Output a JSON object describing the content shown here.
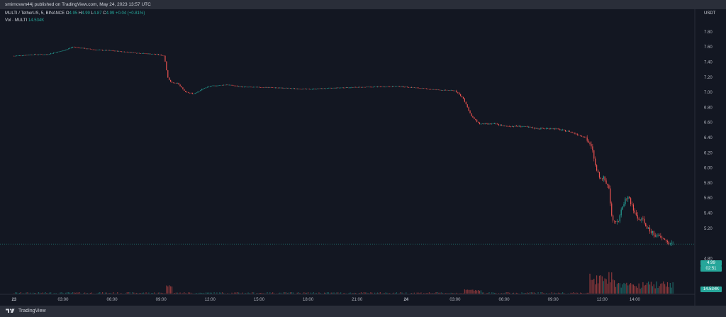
{
  "publisher": {
    "text": "smirnovwn44j published on TradingView.com, May 24, 2023 13:57 UTC"
  },
  "legend": {
    "symbol": "MULTI / TetherUS, 5, BINANCE",
    "o_label": "O",
    "o_value": "4.95",
    "h_label": "H",
    "h_value": "4.99",
    "l_label": "L",
    "l_value": "4.87",
    "c_label": "C",
    "c_value": "4.99",
    "change": "+0.04 (+0.81%)",
    "vol_label": "Vol · MULTI",
    "vol_value": "14.534K"
  },
  "currency": "USDT",
  "price_badge": {
    "price": "4.99",
    "countdown": "02:51"
  },
  "volume_badge": "14.534K",
  "brand": "TradingView",
  "colors": {
    "up": "#26a69a",
    "down": "#ef5350",
    "background": "#131722",
    "text": "#d1d4dc"
  },
  "chart_data": {
    "type": "candlestick",
    "yaxis_labels": [
      "7.80",
      "7.60",
      "7.40",
      "7.20",
      "7.00",
      "6.80",
      "6.60",
      "6.40",
      "6.20",
      "6.00",
      "5.80",
      "5.60",
      "5.40",
      "5.20",
      "4.80"
    ],
    "ylim": [
      4.55,
      7.93
    ],
    "last_price": 4.99,
    "xaxis_labels": [
      "23",
      "03:00",
      "06:00",
      "09:00",
      "12:00",
      "15:00",
      "18:00",
      "21:00",
      "24",
      "03:00",
      "06:00",
      "09:00",
      "12:00",
      "14:00"
    ],
    "xaxis_hours": [
      0,
      3,
      6,
      9,
      12,
      15,
      18,
      21,
      24,
      27,
      30,
      33,
      36,
      38
    ],
    "x_range_hours": [
      -0.6,
      38.0
    ],
    "interval_minutes": 5,
    "price_path": [
      [
        0,
        7.48
      ],
      [
        1.2,
        7.5
      ],
      [
        2,
        7.5
      ],
      [
        3,
        7.55
      ],
      [
        3.6,
        7.6
      ],
      [
        5,
        7.56
      ],
      [
        6,
        7.55
      ],
      [
        7.5,
        7.52
      ],
      [
        8.8,
        7.5
      ],
      [
        9.2,
        7.48
      ],
      [
        9.4,
        7.2
      ],
      [
        9.6,
        7.13
      ],
      [
        10,
        7.12
      ],
      [
        10.5,
        7.0
      ],
      [
        11,
        6.98
      ],
      [
        11.6,
        7.05
      ],
      [
        12,
        7.08
      ],
      [
        13,
        7.1
      ],
      [
        14,
        7.07
      ],
      [
        16,
        7.06
      ],
      [
        18,
        7.04
      ],
      [
        20,
        7.06
      ],
      [
        22,
        7.07
      ],
      [
        23.5,
        7.08
      ],
      [
        24.5,
        7.06
      ],
      [
        26,
        7.03
      ],
      [
        27,
        7.02
      ],
      [
        27.5,
        6.92
      ],
      [
        28,
        6.68
      ],
      [
        28.5,
        6.58
      ],
      [
        29.5,
        6.58
      ],
      [
        30,
        6.55
      ],
      [
        31,
        6.55
      ],
      [
        32,
        6.52
      ],
      [
        33,
        6.52
      ],
      [
        34,
        6.48
      ],
      [
        35,
        6.4
      ],
      [
        35.4,
        6.24
      ],
      [
        35.6,
        6.0
      ],
      [
        35.8,
        5.89
      ],
      [
        36.1,
        5.86
      ],
      [
        36.4,
        5.75
      ],
      [
        36.6,
        5.34
      ],
      [
        36.8,
        5.3
      ],
      [
        37.0,
        5.3
      ],
      [
        37.2,
        5.45
      ],
      [
        37.4,
        5.58
      ],
      [
        37.6,
        5.62
      ],
      [
        37.9,
        5.45
      ],
      [
        38.2,
        5.32
      ],
      [
        38.5,
        5.3
      ],
      [
        38.8,
        5.19
      ],
      [
        39.2,
        5.12
      ],
      [
        39.5,
        5.08
      ],
      [
        39.8,
        5.05
      ],
      [
        40.1,
        5.0
      ],
      [
        40.35,
        4.99
      ]
    ],
    "grid": false
  }
}
